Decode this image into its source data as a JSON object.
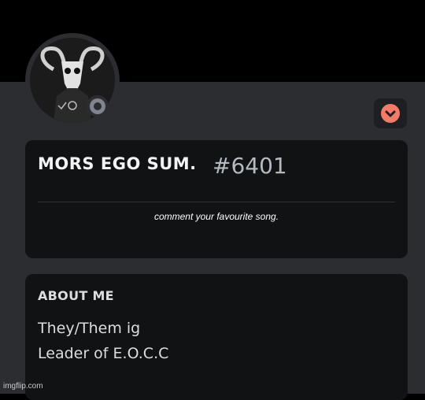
{
  "profile": {
    "username": "MORS EGO SUM.",
    "discriminator": "#6401",
    "status": "offline",
    "status_color": "#80848e",
    "badge_color": "#f47b67",
    "caption": "comment your favourite song."
  },
  "about": {
    "heading": "ABOUT ME",
    "lines": [
      "They/Them ig",
      "Leader of E.O.C.C"
    ]
  },
  "watermark": "imgflip.com",
  "icons": {
    "avatar": "goat-skull-avatar",
    "status": "offline-status-icon",
    "badge": "chevron-down-icon"
  }
}
